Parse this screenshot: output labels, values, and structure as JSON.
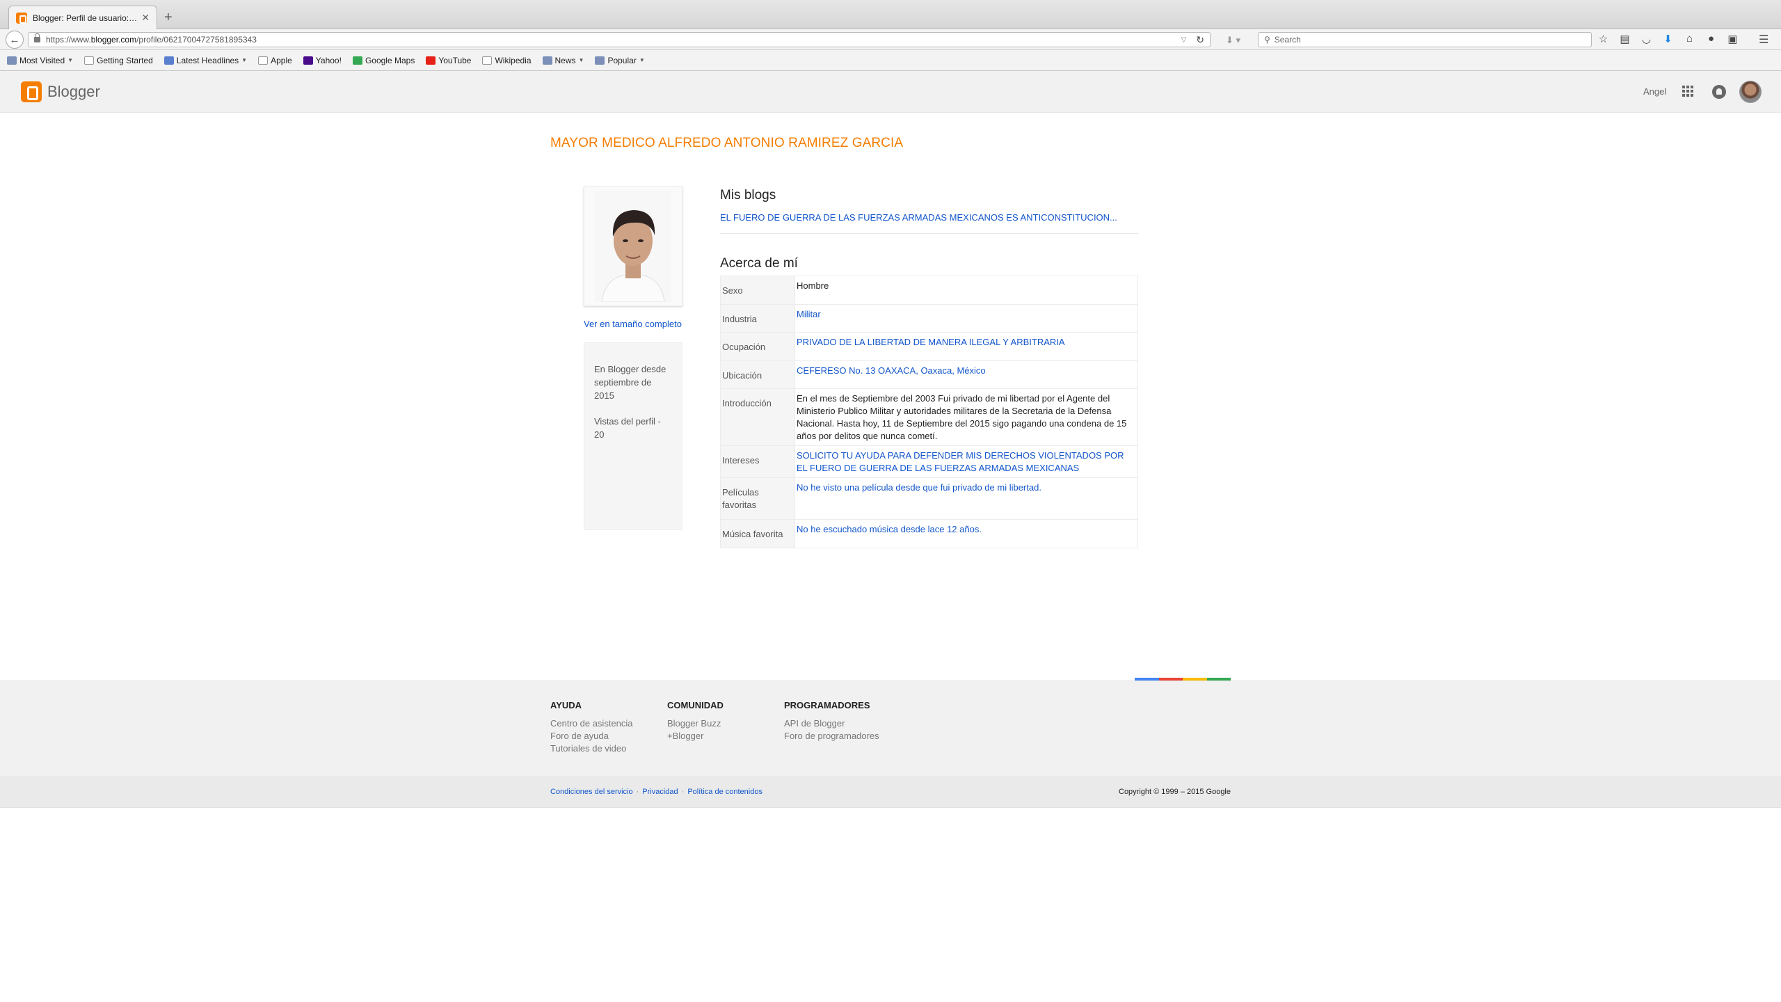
{
  "browser": {
    "tab_title": "Blogger: Perfil de usuario: ...",
    "url_prefix": "https://www.",
    "url_host": "blogger.com",
    "url_path": "/profile/06217004727581895343",
    "search_placeholder": "Search",
    "bookmarks": [
      {
        "label": "Most Visited",
        "icon": "folder-icon",
        "color": "#7b8fb8"
      },
      {
        "label": "Getting Started",
        "icon": "page-icon",
        "color": "#ffffff"
      },
      {
        "label": "Latest Headlines",
        "icon": "rss-icon",
        "color": "#5b7fcf"
      },
      {
        "label": "Apple",
        "icon": "page-icon",
        "color": "#ffffff"
      },
      {
        "label": "Yahoo!",
        "icon": "yahoo-icon",
        "color": "#4a0a8c"
      },
      {
        "label": "Google Maps",
        "icon": "maps-icon",
        "color": "#34a853"
      },
      {
        "label": "YouTube",
        "icon": "youtube-icon",
        "color": "#e62117"
      },
      {
        "label": "Wikipedia",
        "icon": "wikipedia-icon",
        "color": "#ffffff"
      },
      {
        "label": "News",
        "icon": "folder-icon",
        "color": "#7b8fb8"
      },
      {
        "label": "Popular",
        "icon": "folder-icon",
        "color": "#7b8fb8"
      }
    ]
  },
  "header": {
    "brand": "Blogger",
    "brand_color": "#f57d00",
    "user_name": "Angel"
  },
  "profile": {
    "name": "MAYOR MEDICO ALFREDO ANTONIO RAMIREZ GARCIA",
    "full_size_link": "Ver en tamaño completo",
    "since_line1": "En Blogger desde",
    "since_line2": "septiembre de 2015",
    "views": "Vistas del perfil - 20"
  },
  "my_blogs": {
    "heading": "Mis blogs",
    "items": [
      "EL FUERO DE GUERRA DE LAS FUERZAS ARMADAS MEXICANOS ES ANTICONSTITUCION..."
    ]
  },
  "about": {
    "heading": "Acerca de mí",
    "rows": [
      {
        "label": "Sexo",
        "value": "Hombre"
      },
      {
        "label": "Industria",
        "value": "Militar"
      },
      {
        "label": "Ocupación",
        "value": "PRIVADO DE LA LIBERTAD DE MANERA ILEGAL Y ARBITRARIA"
      },
      {
        "label": "Ubicación",
        "value": "CEFERESO No. 13 OAXACA, Oaxaca, México"
      },
      {
        "label": "Introducción",
        "value": "En el mes de Septiembre del 2003 Fui privado de mi libertad por el Agente del Ministerio Publico Militar y autoridades militares de la Secretaria de la Defensa Nacional. Hasta hoy, 11 de Septiembre del 2015 sigo pagando una condena de 15 años por delitos que nunca cometí."
      },
      {
        "label": "Intereses",
        "value": "SOLICITO TU AYUDA PARA DEFENDER MIS DERECHOS VIOLENTADOS POR EL FUERO DE GUERRA DE LAS FUERZAS ARMADAS MEXICANAS"
      },
      {
        "label": "Películas favoritas",
        "value": "No he visto una película desde que fui privado de mi libertad."
      },
      {
        "label": "Música favorita",
        "value": "No he escuchado música desde lace 12 años."
      }
    ]
  },
  "footer": {
    "colors": [
      "#4285f4",
      "#ea4335",
      "#fbbc05",
      "#34a853"
    ],
    "columns": [
      {
        "heading": "AYUDA",
        "links": [
          "Centro de asistencia",
          "Foro de ayuda",
          "Tutoriales de video"
        ]
      },
      {
        "heading": "COMUNIDAD",
        "links": [
          "Blogger Buzz",
          "+Blogger"
        ]
      },
      {
        "heading": "PROGRAMADORES",
        "links": [
          "API de Blogger",
          "Foro de programadores"
        ]
      }
    ],
    "legal_links": [
      "Condiciones del servicio",
      "Privacidad",
      "Política de contenidos"
    ],
    "legal_sep": "·",
    "copyright": "Copyright © 1999 – 2015 Google"
  }
}
